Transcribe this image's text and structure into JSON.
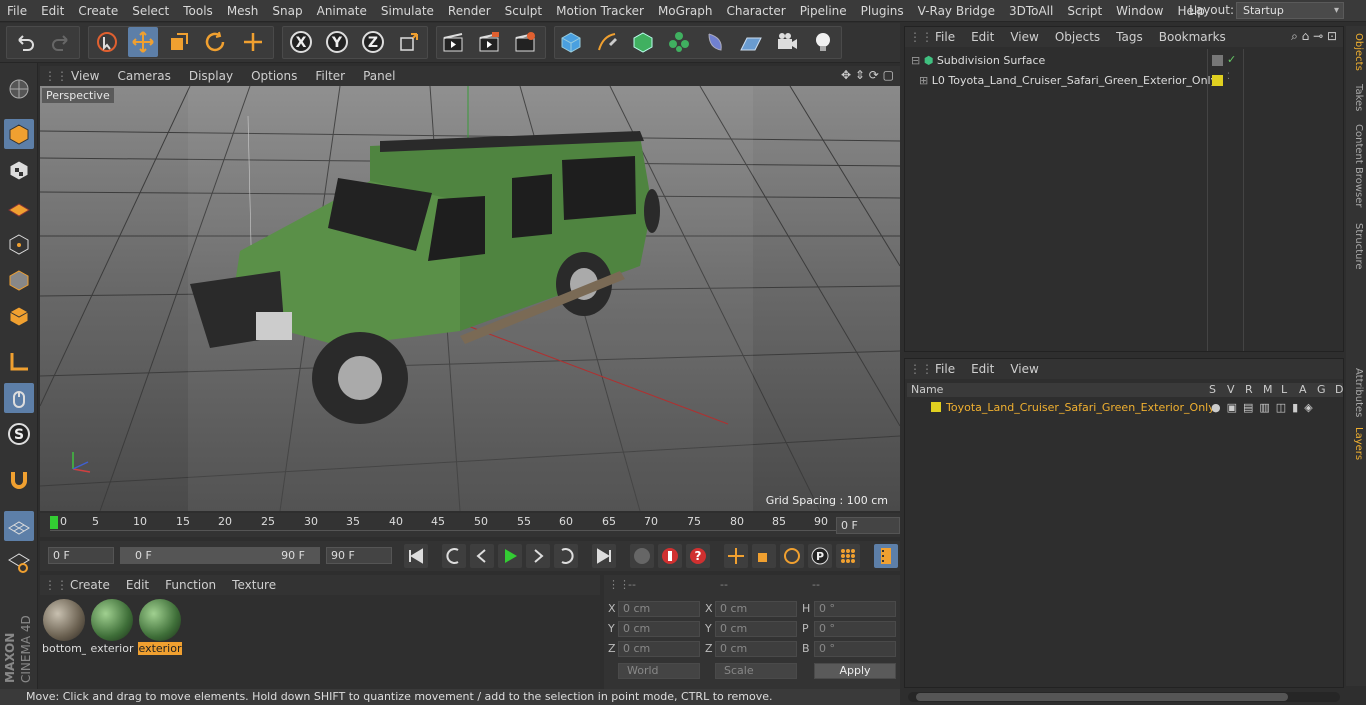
{
  "menubar": {
    "items": [
      "File",
      "Edit",
      "Create",
      "Select",
      "Tools",
      "Mesh",
      "Snap",
      "Animate",
      "Simulate",
      "Render",
      "Sculpt",
      "Motion Tracker",
      "MoGraph",
      "Character",
      "Pipeline",
      "Plugins",
      "V-Ray Bridge",
      "3DToAll",
      "Script",
      "Window",
      "Help"
    ],
    "layout_label": "Layout:",
    "layout_value": "Startup"
  },
  "viewport": {
    "menu": [
      "View",
      "Cameras",
      "Display",
      "Options",
      "Filter",
      "Panel"
    ],
    "camera_label": "Perspective",
    "grid_spacing": "Grid Spacing : 100 cm"
  },
  "timeline": {
    "ticks": [
      "0",
      "5",
      "10",
      "15",
      "20",
      "25",
      "30",
      "35",
      "40",
      "45",
      "50",
      "55",
      "60",
      "65",
      "70",
      "75",
      "80",
      "85",
      "90"
    ],
    "current_frame": "0 F",
    "start_field": "0 F",
    "range_start": "0 F",
    "range_end": "90 F",
    "end_field": "90 F"
  },
  "materials": {
    "menu": [
      "Create",
      "Edit",
      "Function",
      "Texture"
    ],
    "items": [
      {
        "label": "bottom_",
        "selected": false,
        "color": "#8a8070"
      },
      {
        "label": "exterior",
        "selected": false,
        "color": "#3e6e38"
      },
      {
        "label": "exterior",
        "selected": true,
        "color": "#3e6e38"
      }
    ]
  },
  "coordinates": {
    "header": [
      "--",
      "--",
      "--"
    ],
    "rows": [
      {
        "l1": "X",
        "v1": "0 cm",
        "l2": "X",
        "v2": "0 cm",
        "l3": "H",
        "v3": "0 °"
      },
      {
        "l1": "Y",
        "v1": "0 cm",
        "l2": "Y",
        "v2": "0 cm",
        "l3": "P",
        "v3": "0 °"
      },
      {
        "l1": "Z",
        "v1": "0 cm",
        "l2": "Z",
        "v2": "0 cm",
        "l3": "B",
        "v3": "0 °"
      }
    ],
    "world": "World",
    "scale": "Scale",
    "apply": "Apply"
  },
  "objects_panel": {
    "menu": [
      "File",
      "Edit",
      "View",
      "Objects",
      "Tags",
      "Bookmarks"
    ],
    "items": [
      {
        "name": "Subdivision Surface"
      },
      {
        "name": "Toyota_Land_Cruiser_Safari_Green_Exterior_Only"
      }
    ]
  },
  "layers_panel": {
    "menu": [
      "File",
      "Edit",
      "View"
    ],
    "columns": [
      "Name",
      "S",
      "V",
      "R",
      "M",
      "L",
      "A",
      "G",
      "D"
    ],
    "row": "Toyota_Land_Cruiser_Safari_Green_Exterior_Only"
  },
  "right_tabs": [
    "Objects",
    "Takes",
    "Content Browser",
    "Structure",
    "Attributes",
    "Layers"
  ],
  "branding": {
    "maxon": "MAXON",
    "product": "CINEMA 4D"
  },
  "status": "Move: Click and drag to move elements. Hold down SHIFT to quantize movement / add to the selection in point mode, CTRL to remove.",
  "colors": {
    "accent": "#5d7fa8",
    "selection": "#f0a030",
    "layer_yellow": "#e0d020"
  }
}
